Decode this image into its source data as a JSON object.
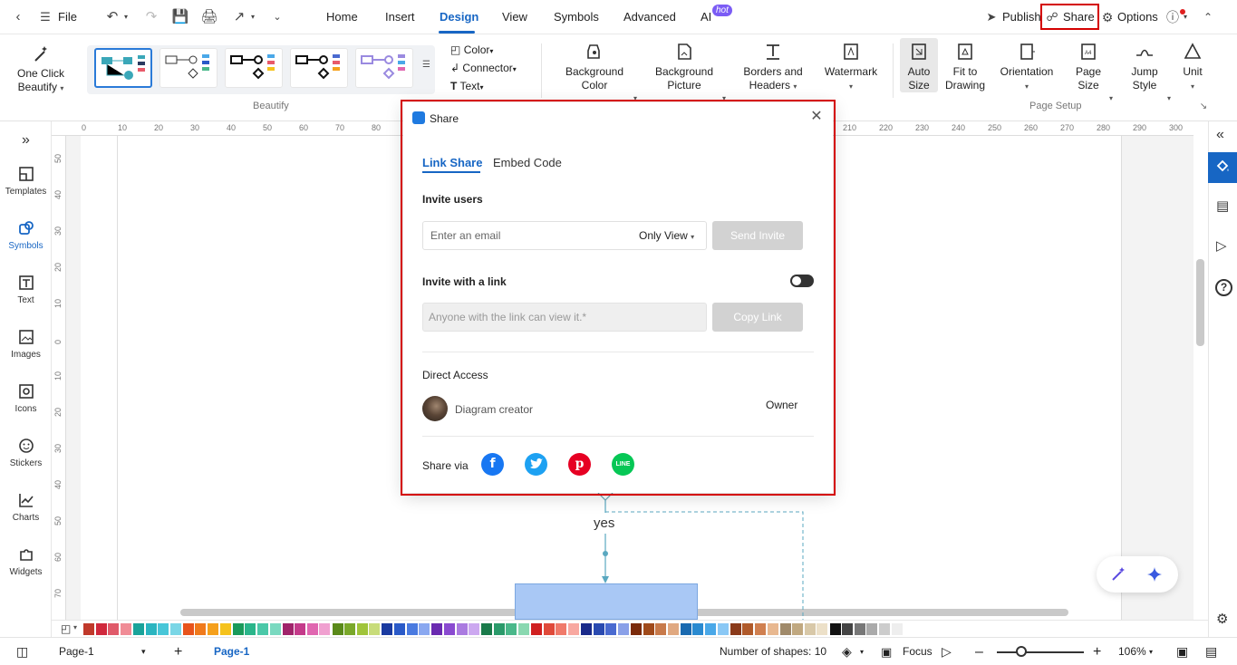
{
  "menubar": {
    "file": "File",
    "tabs": [
      "Home",
      "Insert",
      "Design",
      "View",
      "Symbols",
      "Advanced",
      "AI"
    ],
    "active_tab": "Design",
    "hot_badge": "hot",
    "publish": "Publish",
    "share": "Share",
    "options": "Options"
  },
  "ribbon": {
    "one_click": [
      "One Click",
      "Beautify"
    ],
    "beautify_label": "Beautify",
    "color": "Color",
    "connector": "Connector",
    "text": "Text",
    "background_color": [
      "Background",
      "Color"
    ],
    "background_picture": [
      "Background",
      "Picture"
    ],
    "borders_headers": [
      "Borders and",
      "Headers"
    ],
    "watermark": "Watermark",
    "auto_size": [
      "Auto",
      "Size"
    ],
    "fit_to_drawing": [
      "Fit to",
      "Drawing"
    ],
    "orientation": "Orientation",
    "page_size": [
      "Page",
      "Size"
    ],
    "jump_style": [
      "Jump",
      "Style"
    ],
    "unit": "Unit",
    "page_setup_label": "Page Setup"
  },
  "sidebar": {
    "items": [
      "Templates",
      "Symbols",
      "Text",
      "Images",
      "Icons",
      "Stickers",
      "Charts",
      "Widgets"
    ],
    "active": "Symbols"
  },
  "ruler": {
    "top": [
      "0",
      "10",
      "20",
      "30",
      "40",
      "50",
      "60",
      "70",
      "80",
      "210",
      "220",
      "230",
      "240",
      "250",
      "260",
      "270",
      "280",
      "290",
      "300"
    ],
    "left": [
      "50",
      "40",
      "30",
      "20",
      "10",
      "0",
      "10",
      "20",
      "30",
      "40",
      "50",
      "60",
      "70"
    ]
  },
  "canvas": {
    "yes_label": "yes"
  },
  "dialog": {
    "title": "Share",
    "tab_link": "Link Share",
    "tab_embed": "Embed Code",
    "invite_users": "Invite users",
    "email_placeholder": "Enter an email",
    "permission": "Only View",
    "send_invite": "Send Invite",
    "invite_link": "Invite with a link",
    "link_text": "Anyone with the link can view it.*",
    "copy_link": "Copy Link",
    "direct_access": "Direct Access",
    "member_name": "Diagram creator",
    "member_role": "Owner",
    "share_via": "Share via"
  },
  "status": {
    "page_select": "Page-1",
    "page_tab": "Page-1",
    "shapes": "Number of shapes: 10",
    "focus": "Focus",
    "zoom": "106%"
  },
  "palette": [
    "#c0392b",
    "#d0283c",
    "#e05a6a",
    "#f08c96",
    "#1aa39a",
    "#2bb5c0",
    "#48c6d8",
    "#7ad6e6",
    "#e8541c",
    "#f07a1c",
    "#f5a01c",
    "#f5c21c",
    "#1a9a5a",
    "#2ab58a",
    "#4bc8a8",
    "#7ad9c0",
    "#a0236a",
    "#c43a8a",
    "#e066b0",
    "#f0a0d0",
    "#5a8a1a",
    "#7aa82a",
    "#a0c43a",
    "#c8dc7a",
    "#1a3aa0",
    "#2a5ac8",
    "#4a7ae0",
    "#8aa8f0",
    "#6a2ab0",
    "#8a4ad0",
    "#aa7ae0",
    "#cca8f0",
    "#1a7a4a",
    "#2a9a6a",
    "#4ab88a",
    "#8ad8b0",
    "#d02020",
    "#e04a3a",
    "#f07a6a",
    "#f8a8a0",
    "#1a2a8a",
    "#2a4ab0",
    "#4a6ad0",
    "#8aa0e8",
    "#7a2a0a",
    "#a04a1a",
    "#c87a4a",
    "#e0a880",
    "#1a6ab0",
    "#2a8ad0",
    "#4aa8e8",
    "#8ac8f5",
    "#8a3a1a",
    "#b05a2a",
    "#d08050",
    "#e8b890",
    "#a08a6a",
    "#c0a880",
    "#d8c8a8",
    "#ece0c8",
    "#111111",
    "#444444",
    "#777777",
    "#aaaaaa",
    "#cccccc",
    "#eeeeee"
  ]
}
